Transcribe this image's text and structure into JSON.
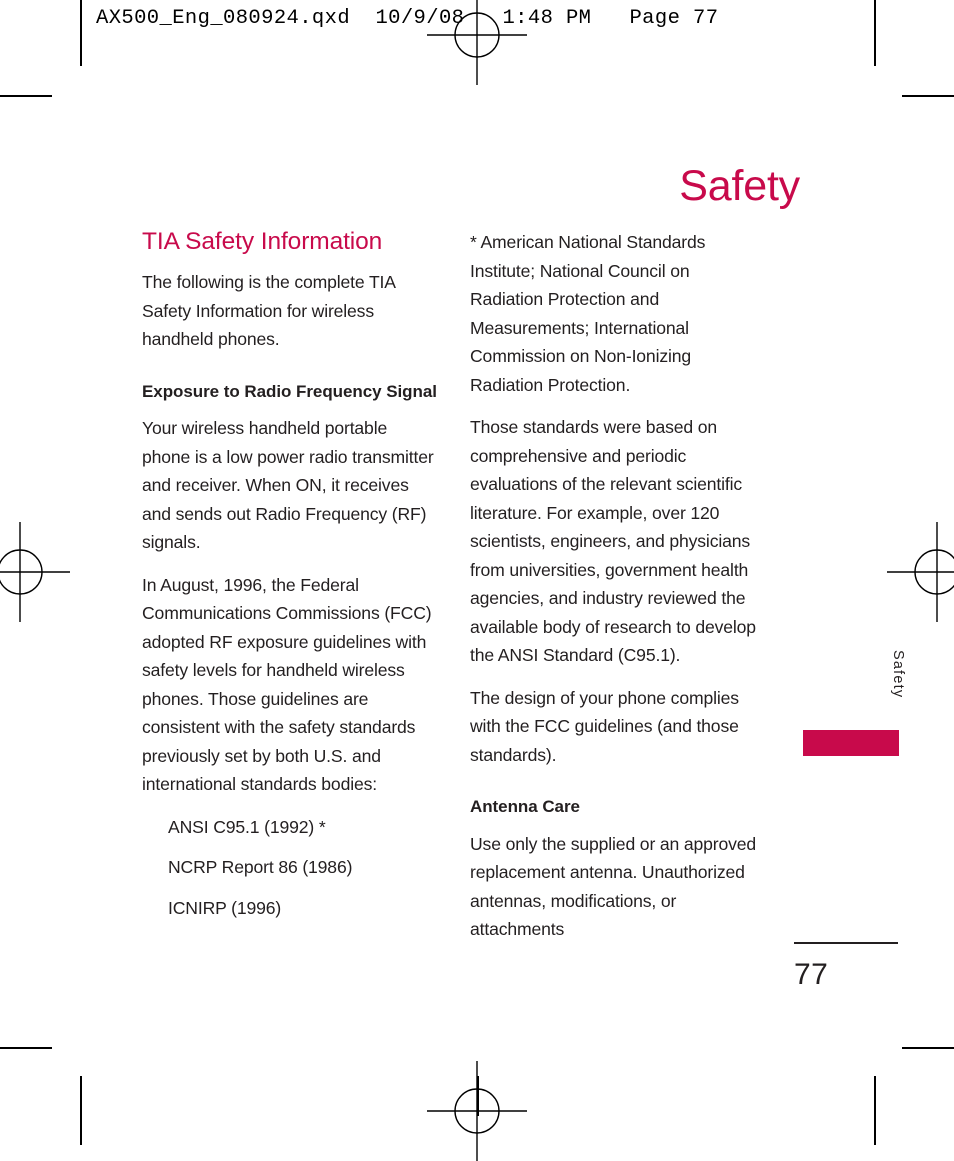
{
  "prepress": {
    "header_line": "AX500_Eng_080924.qxd  10/9/08   1:48 PM   Page 77"
  },
  "colors": {
    "accent_crimson": "#c80a4b",
    "body_text": "#231f20"
  },
  "page": {
    "title": "Safety",
    "side_tab_label": "Safety",
    "folio": "77"
  },
  "left_column": {
    "section_heading": "TIA Safety Information",
    "intro_paragraph": "The following is the complete TIA Safety Information for wireless handheld phones.",
    "sub_heading": "Exposure to Radio Frequency Signal",
    "paragraph_1": "Your wireless handheld portable phone is a low power radio transmitter and receiver. When ON, it receives and sends out Radio Frequency (RF) signals.",
    "paragraph_2": "In August, 1996, the Federal Communications Commissions (FCC) adopted RF exposure guidelines with safety levels for handheld wireless phones. Those guidelines are consistent with the safety standards previously set by both U.S. and international standards bodies:",
    "standards": [
      "ANSI C95.1 (1992) *",
      "NCRP Report 86 (1986)",
      "ICNIRP (1996)"
    ]
  },
  "right_column": {
    "footnote_paragraph": "* American National Standards Institute; National Council on Radiation Protection and Measurements; International Commission on Non-Ionizing Radiation Protection.",
    "paragraph_1": "Those standards were based on comprehensive and periodic evaluations of the relevant scientific literature. For example, over 120 scientists, engineers, and physicians from universities, government health agencies, and industry reviewed the available body of research to develop the ANSI Standard (C95.1).",
    "paragraph_2": "The design of your phone complies with the FCC guidelines (and those standards).",
    "sub_heading": "Antenna Care",
    "paragraph_3": "Use only the supplied or an approved replacement antenna. Unauthorized antennas, modifications, or attachments"
  }
}
